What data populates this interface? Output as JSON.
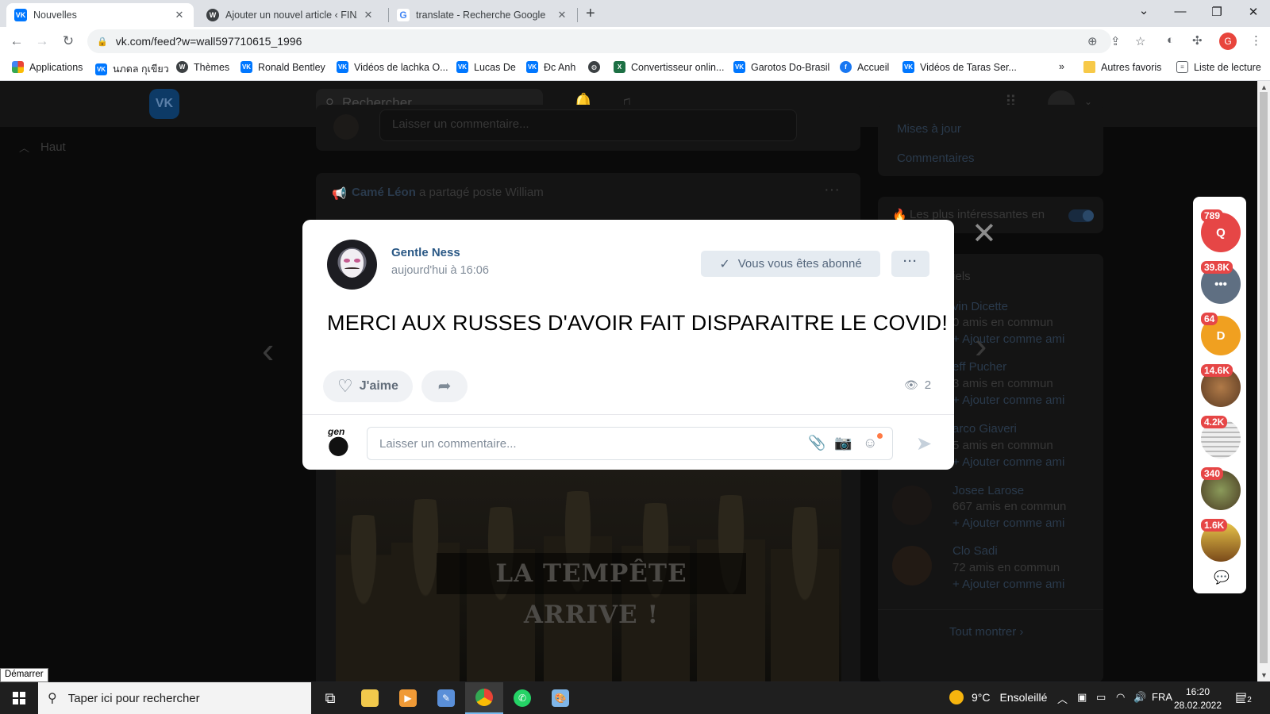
{
  "browser": {
    "tabs": [
      {
        "title": "Nouvelles",
        "icon": "vk-icon",
        "active": true
      },
      {
        "title": "Ajouter un nouvel article ‹ FINAL",
        "icon": "wordpress-icon",
        "active": false
      },
      {
        "title": "translate - Recherche Google",
        "icon": "google-icon",
        "active": false
      }
    ],
    "url": "vk.com/feed?w=wall597710615_1996",
    "profile_initial": "G",
    "bookmarks": [
      {
        "label": "Applications",
        "icon": "apps-grid-icon"
      },
      {
        "label": "นภดล กุเขียว",
        "icon": "vk-icon"
      },
      {
        "label": "Thèmes",
        "icon": "wordpress-icon"
      },
      {
        "label": "Ronald Bentley",
        "icon": "vk-icon"
      },
      {
        "label": "Vidéos de lachka O...",
        "icon": "vk-icon"
      },
      {
        "label": "Lucas De",
        "icon": "vk-icon"
      },
      {
        "label": "Đc Anh",
        "icon": "vk-icon"
      },
      {
        "label": "",
        "icon": "globe-icon"
      },
      {
        "label": "Convertisseur onlin...",
        "icon": "excel-icon"
      },
      {
        "label": "Garotos Do-Brasil",
        "icon": "vk-icon"
      },
      {
        "label": "Accueil",
        "icon": "facebook-icon"
      },
      {
        "label": "Vidéos de Taras Ser...",
        "icon": "vk-icon"
      },
      {
        "label": "Autres favoris",
        "icon": "folder-icon"
      },
      {
        "label": "Liste de lecture",
        "icon": "reading-list-icon"
      }
    ],
    "bookmarks_more": "»"
  },
  "vk": {
    "logo": "VK",
    "search_placeholder": "Rechercher",
    "back_to_top": "Haut",
    "background": {
      "comment_placeholder": "Laisser un commentaire...",
      "share_author": "Camé Léon",
      "share_text": "a partagé poste William",
      "menu_updates": "Mises à jour",
      "menu_comments": "Commentaires",
      "interesting_toggle": "Les plus intéressantes en",
      "friends_title": "tiels",
      "photo_caption": "LA TEMPÊTE ARRIVE !",
      "show_all": "Tout montrer",
      "friends": [
        {
          "name": "vin Dicette",
          "mutual": "0 amis en commun",
          "action": "Ajouter comme ami"
        },
        {
          "name": "eff Pucher",
          "mutual": "3 amis en commun",
          "action": "Ajouter comme ami"
        },
        {
          "name": "arco Giaveri",
          "mutual": "5 amis en commun",
          "action": "Ajouter comme ami"
        },
        {
          "name": "Josee Larose",
          "mutual": "667 amis en commun",
          "action": "Ajouter comme ami"
        },
        {
          "name": "Clo Sadi",
          "mutual": "72 amis en commun",
          "action": "Ajouter comme ami"
        }
      ]
    },
    "post": {
      "author": "Gentle Ness",
      "time": "aujourd'hui à 16:06",
      "subscribe_label": "Vous vous êtes abonné",
      "more_label": "···",
      "text": "MERCI AUX RUSSES D'AVOIR FAIT DISPARAITRE LE COVID!",
      "like_label": "J'aime",
      "views": "2",
      "comment_placeholder": "Laisser un commentaire..."
    },
    "rail": [
      {
        "badge": "789",
        "letter": "Q",
        "color": "#e64646"
      },
      {
        "badge": "39.8K",
        "letter": "",
        "color": "#5f6f82"
      },
      {
        "badge": "64",
        "letter": "D",
        "color": "#f0a020"
      },
      {
        "badge": "14.6K",
        "letter": "",
        "color": "#7a5a3a"
      },
      {
        "badge": "4.2K",
        "letter": "",
        "color": "#d8d8d8"
      },
      {
        "badge": "340",
        "letter": "",
        "color": "#6b7a4a"
      },
      {
        "badge": "1.6K",
        "letter": "",
        "color": "#c9a23a"
      }
    ]
  },
  "tooltip": "Démarrer",
  "taskbar": {
    "search_placeholder": "Taper ici pour rechercher",
    "temperature": "9°C",
    "condition": "Ensoleillé",
    "language": "FRA",
    "time": "16:20",
    "date": "28.02.2022",
    "notifications": "2"
  }
}
